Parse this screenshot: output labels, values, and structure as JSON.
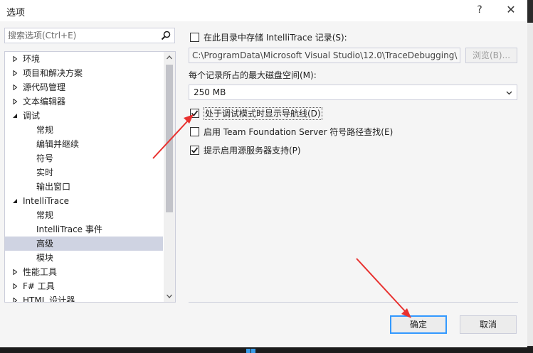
{
  "window": {
    "title": "选项",
    "help_label": "?",
    "close_label": "✕"
  },
  "search": {
    "placeholder": "搜索选项(Ctrl+E)"
  },
  "tree": {
    "items": [
      {
        "label": "环境",
        "level": 0,
        "expander": "collapsed",
        "selected": false
      },
      {
        "label": "项目和解决方案",
        "level": 0,
        "expander": "collapsed",
        "selected": false
      },
      {
        "label": "源代码管理",
        "level": 0,
        "expander": "collapsed",
        "selected": false
      },
      {
        "label": "文本编辑器",
        "level": 0,
        "expander": "collapsed",
        "selected": false
      },
      {
        "label": "调试",
        "level": 0,
        "expander": "expanded",
        "selected": false
      },
      {
        "label": "常规",
        "level": 1,
        "expander": "none",
        "selected": false
      },
      {
        "label": "编辑并继续",
        "level": 1,
        "expander": "none",
        "selected": false
      },
      {
        "label": "符号",
        "level": 1,
        "expander": "none",
        "selected": false
      },
      {
        "label": "实时",
        "level": 1,
        "expander": "none",
        "selected": false
      },
      {
        "label": "输出窗口",
        "level": 1,
        "expander": "none",
        "selected": false
      },
      {
        "label": "IntelliTrace",
        "level": 0,
        "expander": "expanded",
        "selected": false
      },
      {
        "label": "常规",
        "level": 1,
        "expander": "none",
        "selected": false
      },
      {
        "label": "IntelliTrace 事件",
        "level": 1,
        "expander": "none",
        "selected": false
      },
      {
        "label": "高级",
        "level": 1,
        "expander": "none",
        "selected": true
      },
      {
        "label": "模块",
        "level": 1,
        "expander": "none",
        "selected": false
      },
      {
        "label": "性能工具",
        "level": 0,
        "expander": "collapsed",
        "selected": false
      },
      {
        "label": "F# 工具",
        "level": 0,
        "expander": "collapsed",
        "selected": false
      },
      {
        "label": "HTML 设计器",
        "level": 0,
        "expander": "collapsed",
        "selected": false
      }
    ]
  },
  "options": {
    "store_recordings": {
      "label": "在此目录中存储 IntelliTrace 记录(S):",
      "checked": false
    },
    "recording_path": "C:\\ProgramData\\Microsoft Visual Studio\\12.0\\TraceDebugging\\",
    "browse_label": "浏览(B)...",
    "max_size_label": "每个记录所占的最大磁盘空间(M):",
    "max_size_value": "250 MB",
    "show_nav_gutter": {
      "label": "处于调试模式时显示导航线(D)",
      "checked": true
    },
    "tfs_symbols": {
      "label": "启用 Team Foundation Server 符号路径查找(E)",
      "checked": false
    },
    "source_server": {
      "label": "提示启用源服务器支持(P)",
      "checked": true
    }
  },
  "buttons": {
    "ok_label": "确定",
    "cancel_label": "取消"
  },
  "colors": {
    "accent": "#3399ff",
    "selection": "#cfd3e2",
    "annotation": "#e8312f"
  }
}
